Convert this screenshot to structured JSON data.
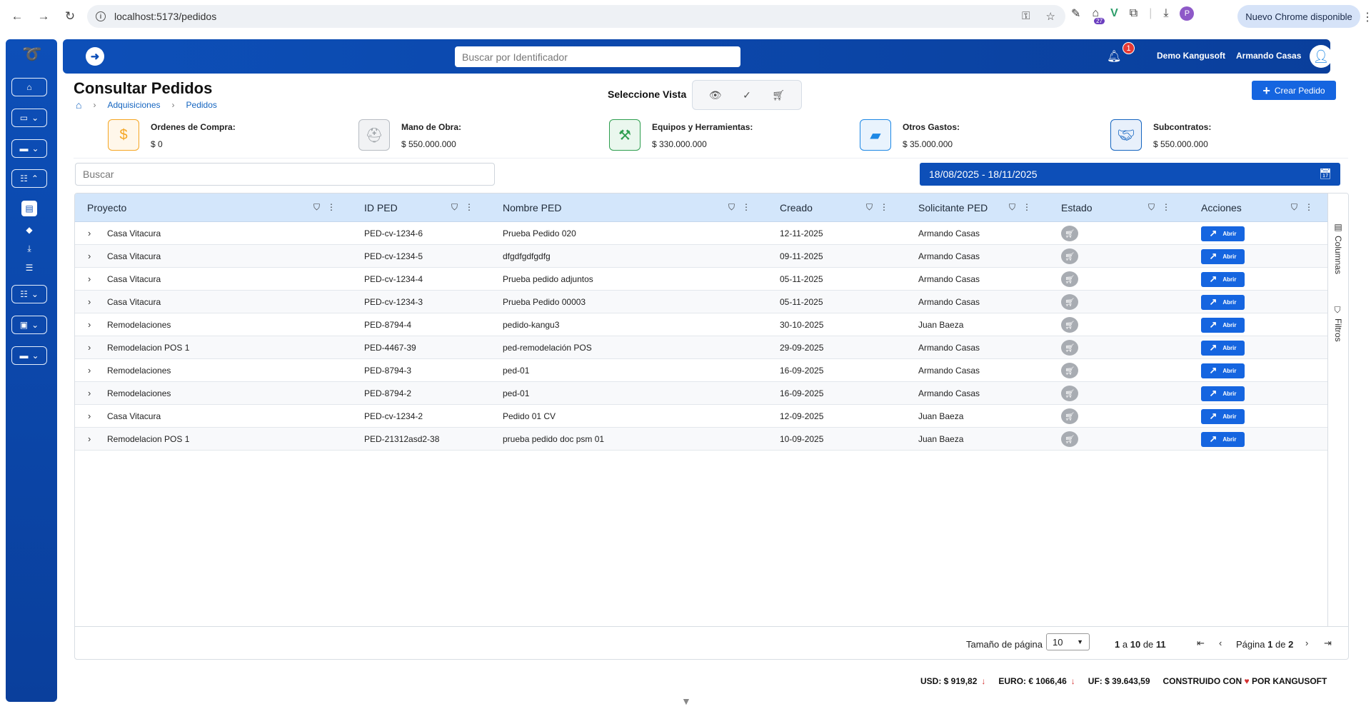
{
  "browser": {
    "url": "localhost:5173/pedidos",
    "update_label": "Nuevo Chrome disponible",
    "extension_badge": "27",
    "profile_initial": "P"
  },
  "header": {
    "search_placeholder": "Buscar por Identificador",
    "notifications": "1",
    "company": "Demo Kangusoft",
    "user": "Armando Casas"
  },
  "page": {
    "title": "Consultar Pedidos",
    "breadcrumb": [
      "Adquisiciones",
      "Pedidos"
    ],
    "view_label": "Seleccione Vista",
    "create_label": "Crear Pedido"
  },
  "summary": [
    {
      "label": "Ordenes de Compra:",
      "value": "$ 0",
      "icon": "dollar-icon",
      "color": "#f5a623"
    },
    {
      "label": "Mano de Obra:",
      "value": "$ 550.000.000",
      "icon": "helmet-icon",
      "color": "#9ea3a8"
    },
    {
      "label": "Equipos y Herramientas:",
      "value": "$ 330.000.000",
      "icon": "hammer-icon",
      "color": "#2e9e4f"
    },
    {
      "label": "Otros Gastos:",
      "value": "$ 35.000.000",
      "icon": "wallet-icon",
      "color": "#1e88e5"
    },
    {
      "label": "Subcontratos:",
      "value": "$ 550.000.000",
      "icon": "handshake-icon",
      "color": "#1565c0"
    }
  ],
  "filters": {
    "search_placeholder": "Buscar",
    "date_range": "18/08/2025 - 18/11/2025"
  },
  "table": {
    "columns": [
      "Proyecto",
      "ID PED",
      "Nombre PED",
      "Creado",
      "Solicitante PED",
      "Estado",
      "Acciones"
    ],
    "action_label": "Abrir",
    "rows": [
      {
        "proyecto": "Casa Vitacura",
        "id": "PED-cv-1234-6",
        "nombre": "Prueba Pedido 020",
        "creado": "12-11-2025",
        "solicitante": "Armando Casas"
      },
      {
        "proyecto": "Casa Vitacura",
        "id": "PED-cv-1234-5",
        "nombre": "dfgdfgdfgdfg",
        "creado": "09-11-2025",
        "solicitante": "Armando Casas"
      },
      {
        "proyecto": "Casa Vitacura",
        "id": "PED-cv-1234-4",
        "nombre": "Prueba pedido adjuntos",
        "creado": "05-11-2025",
        "solicitante": "Armando Casas"
      },
      {
        "proyecto": "Casa Vitacura",
        "id": "PED-cv-1234-3",
        "nombre": "Prueba Pedido 00003",
        "creado": "05-11-2025",
        "solicitante": "Armando Casas"
      },
      {
        "proyecto": "Remodelaciones",
        "id": "PED-8794-4",
        "nombre": "pedido-kangu3",
        "creado": "30-10-2025",
        "solicitante": "Juan Baeza"
      },
      {
        "proyecto": "Remodelacion POS 1",
        "id": "PED-4467-39",
        "nombre": "ped-remodelación POS",
        "creado": "29-09-2025",
        "solicitante": "Armando Casas"
      },
      {
        "proyecto": "Remodelaciones",
        "id": "PED-8794-3",
        "nombre": "ped-01",
        "creado": "16-09-2025",
        "solicitante": "Armando Casas"
      },
      {
        "proyecto": "Remodelaciones",
        "id": "PED-8794-2",
        "nombre": "ped-01",
        "creado": "16-09-2025",
        "solicitante": "Armando Casas"
      },
      {
        "proyecto": "Casa Vitacura",
        "id": "PED-cv-1234-2",
        "nombre": "Pedido 01 CV",
        "creado": "12-09-2025",
        "solicitante": "Juan Baeza"
      },
      {
        "proyecto": "Remodelacion POS 1",
        "id": "PED-21312asd2-38",
        "nombre": "prueba pedido doc psm 01",
        "creado": "10-09-2025",
        "solicitante": "Juan Baeza"
      }
    ],
    "side_tabs": [
      "Columnas",
      "Filtros"
    ]
  },
  "pager": {
    "page_size_label": "Tamaño de página",
    "page_size": "10",
    "range_from": "1",
    "range_to": "10",
    "range_total": "11",
    "range_a": "a",
    "range_de": "de",
    "page_label": "Página",
    "page_current": "1",
    "page_de": "de",
    "page_total": "2"
  },
  "footer": {
    "usd": "USD: $ 919,82",
    "euro": "EURO: € 1066,46",
    "uf": "UF: $ 39.643,59",
    "built_prefix": "CONSTRUIDO CON",
    "built_suffix": "POR KANGUSOFT"
  }
}
